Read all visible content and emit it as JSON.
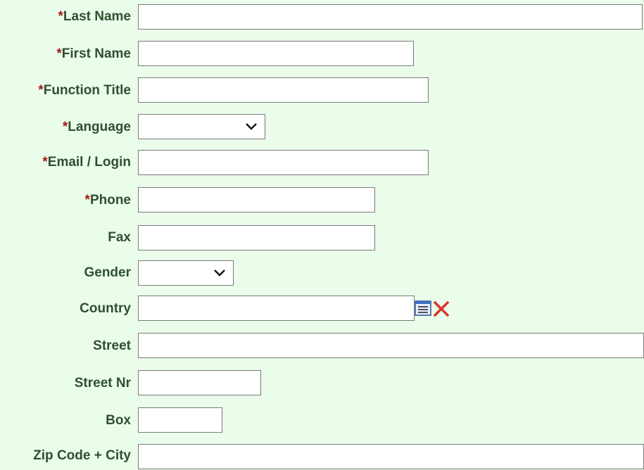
{
  "form": {
    "required_marker": "*",
    "fields": {
      "last_name": {
        "label": "Last Name",
        "required": true,
        "value": ""
      },
      "first_name": {
        "label": "First Name",
        "required": true,
        "value": ""
      },
      "function_title": {
        "label": "Function Title",
        "required": true,
        "value": ""
      },
      "language": {
        "label": "Language",
        "required": true,
        "selected": ""
      },
      "email_login": {
        "label": "Email / Login",
        "required": true,
        "value": ""
      },
      "phone": {
        "label": "Phone",
        "required": true,
        "value": ""
      },
      "fax": {
        "label": "Fax",
        "required": false,
        "value": ""
      },
      "gender": {
        "label": "Gender",
        "required": false,
        "selected": ""
      },
      "country": {
        "label": "Country",
        "required": false,
        "value": ""
      },
      "street": {
        "label": "Street",
        "required": false,
        "value": ""
      },
      "street_nr": {
        "label": "Street Nr",
        "required": false,
        "value": ""
      },
      "box": {
        "label": "Box",
        "required": false,
        "value": ""
      },
      "zip_city": {
        "label": "Zip Code + City",
        "required": false,
        "value": ""
      }
    },
    "icons": {
      "country_lookup": "list-lookup-icon",
      "country_clear": "clear-x-icon"
    }
  }
}
